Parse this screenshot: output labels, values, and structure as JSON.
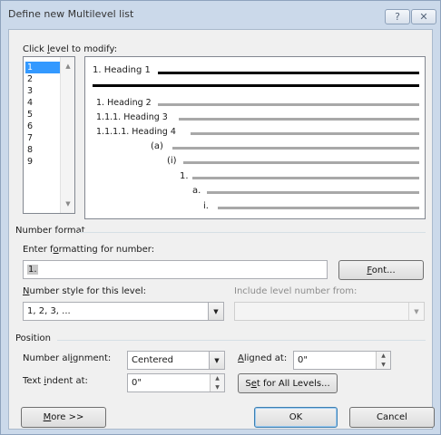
{
  "window": {
    "title": "Define new Multilevel list",
    "help_glyph": "?",
    "close_glyph": "✕"
  },
  "levels": {
    "label_pre": "Click ",
    "label_key": "l",
    "label_post": "evel to modify:",
    "items": [
      "1",
      "2",
      "3",
      "4",
      "5",
      "6",
      "7",
      "8",
      "9"
    ],
    "selected": "1"
  },
  "preview": {
    "h1": "1. Heading 1",
    "h2": "1. Heading 2",
    "h3": "1.1.1. Heading 3",
    "h4": "1.1.1.1. Heading 4",
    "l5": "(a)",
    "l6": "(i)",
    "l7": "1.",
    "l8": "a.",
    "l9": "i."
  },
  "number_format": {
    "section_label": "Number format",
    "enter_label_pre": "Enter f",
    "enter_label_key": "o",
    "enter_label_post": "rmatting for number:",
    "value": "1.",
    "font_button_key": "F",
    "font_button_post": "ont...",
    "style_label_key": "N",
    "style_label_post": "umber style for this level:",
    "style_value": "1, 2, 3, ...",
    "include_label": "Include level number from:",
    "include_value": ""
  },
  "position": {
    "section_label": "Position",
    "alignment_label_pre": "Number al",
    "alignment_label_key": "i",
    "alignment_label_post": "gnment:",
    "alignment_value": "Centered",
    "aligned_at_key": "A",
    "aligned_at_post": "ligned at:",
    "aligned_at_value": "0\"",
    "indent_label_pre": "Text ",
    "indent_label_key": "i",
    "indent_label_post": "ndent at:",
    "indent_value": "0\"",
    "set_all_pre": "S",
    "set_all_key": "e",
    "set_all_post": "t for All Levels..."
  },
  "buttons": {
    "more_key": "M",
    "more_post": "ore >>",
    "ok": "OK",
    "cancel": "Cancel"
  },
  "icons": {
    "scroll_up": "▲",
    "scroll_down": "▼",
    "dropdown": "▼",
    "spin_up": "▲",
    "spin_down": "▼"
  }
}
